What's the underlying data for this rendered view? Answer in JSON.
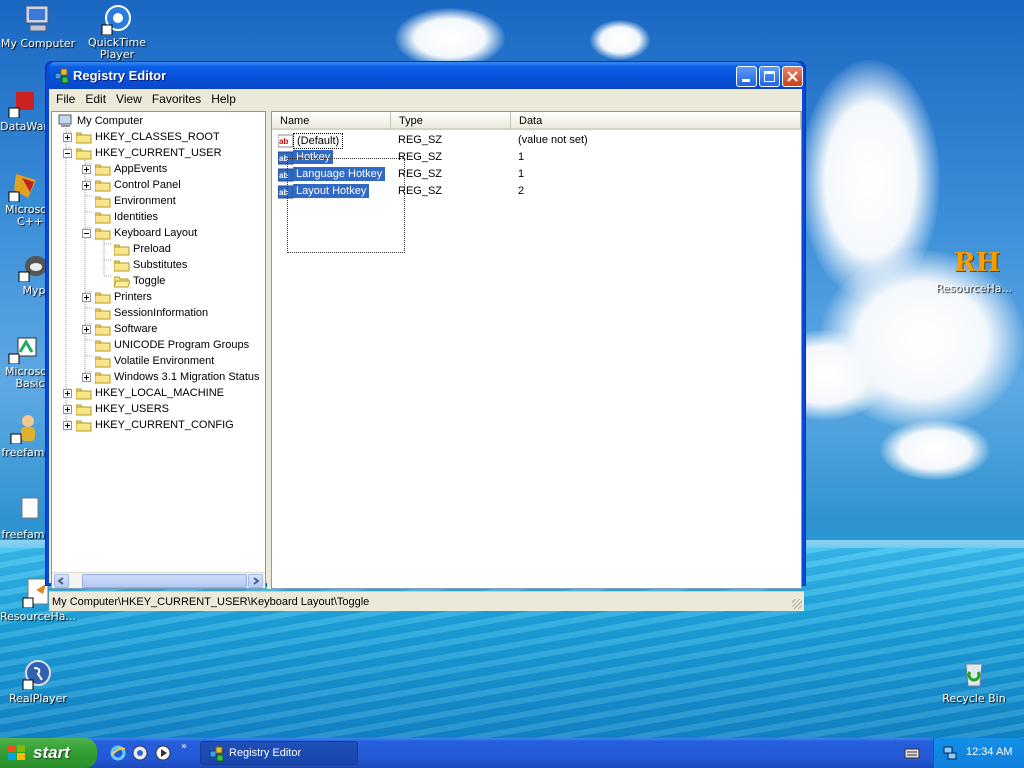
{
  "desktop": {
    "icons_left": [
      {
        "label": "My Computer"
      },
      {
        "label": "QuickTime Player"
      },
      {
        "label": "DataWar"
      },
      {
        "label": "Microsoft C++"
      },
      {
        "label": "Myp"
      },
      {
        "label": "Microsoft Basic"
      },
      {
        "label": "freefamil"
      },
      {
        "label": "freefamil"
      },
      {
        "label": "ResourceHa..."
      },
      {
        "label": "RealPlayer"
      }
    ],
    "icons_right": [
      {
        "label": "ResourceHa..."
      },
      {
        "label": "Recycle Bin"
      }
    ],
    "rh_logo_text": "RH"
  },
  "window": {
    "title": "Registry Editor",
    "menu": [
      "File",
      "Edit",
      "View",
      "Favorites",
      "Help"
    ],
    "tree": [
      {
        "label": "My Computer"
      },
      {
        "label": "HKEY_CLASSES_ROOT"
      },
      {
        "label": "HKEY_CURRENT_USER"
      },
      {
        "label": "AppEvents"
      },
      {
        "label": "Control Panel"
      },
      {
        "label": "Environment"
      },
      {
        "label": "Identities"
      },
      {
        "label": "Keyboard Layout"
      },
      {
        "label": "Preload"
      },
      {
        "label": "Substitutes"
      },
      {
        "label": "Toggle"
      },
      {
        "label": "Printers"
      },
      {
        "label": "SessionInformation"
      },
      {
        "label": "Software"
      },
      {
        "label": "UNICODE Program Groups"
      },
      {
        "label": "Volatile Environment"
      },
      {
        "label": "Windows 3.1 Migration Status"
      },
      {
        "label": "HKEY_LOCAL_MACHINE"
      },
      {
        "label": "HKEY_USERS"
      },
      {
        "label": "HKEY_CURRENT_CONFIG"
      }
    ],
    "columns": [
      "Name",
      "Type",
      "Data"
    ],
    "values": [
      {
        "name": "(Default)",
        "type": "REG_SZ",
        "data": "(value not set)"
      },
      {
        "name": "Hotkey",
        "type": "REG_SZ",
        "data": "1"
      },
      {
        "name": "Language Hotkey",
        "type": "REG_SZ",
        "data": "1"
      },
      {
        "name": "Layout Hotkey",
        "type": "REG_SZ",
        "data": "2"
      }
    ],
    "status": "My Computer\\HKEY_CURRENT_USER\\Keyboard Layout\\Toggle"
  },
  "taskbar": {
    "start_label": "start",
    "task_label": "Registry Editor",
    "clock": "12:34 AM"
  }
}
